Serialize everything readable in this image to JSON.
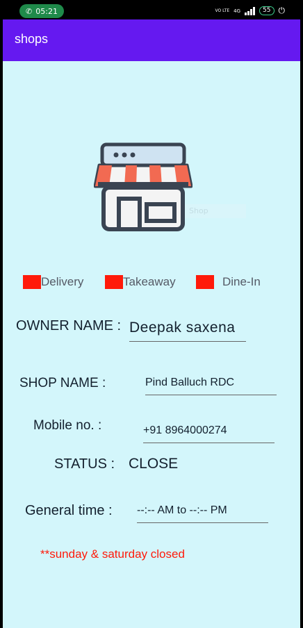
{
  "status_bar": {
    "time": "05:21",
    "network": "VO LTE",
    "network_type": "4G",
    "battery": "55"
  },
  "app_bar": {
    "title": "shops"
  },
  "shop_image": {
    "overlay_placeholder": "Shop"
  },
  "options": [
    {
      "label": "Delivery"
    },
    {
      "label": "Takeaway"
    },
    {
      "label": "Dine-In"
    }
  ],
  "owner": {
    "label": "OWNER NAME :",
    "value": "Deepak saxena"
  },
  "shop": {
    "label": "SHOP NAME :",
    "value": "Pind Balluch RDC"
  },
  "mobile": {
    "label": "Mobile no. :",
    "value": "+91 8964000274"
  },
  "status": {
    "label": "STATUS :",
    "value": "CLOSE"
  },
  "general_time": {
    "label": "General time :",
    "value": "--:-- AM to --:-- PM"
  },
  "closed_note": "**sunday & saturday closed",
  "colors": {
    "app_bar": "#6519f0",
    "background": "#d3f6fb",
    "checkbox": "#ff1a0a",
    "note": "#ff1a0a"
  }
}
